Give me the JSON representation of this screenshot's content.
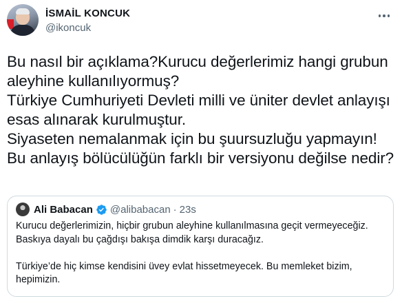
{
  "author": {
    "name": "İSMAİL KONCUK",
    "handle": "@ikoncuk"
  },
  "tweet_text": "Bu nasıl bir açıklama?Kurucu değerlerimiz hangi grubun aleyhine kullanılıyormuş?\nTürkiye Cumhuriyeti Devleti milli ve üniter devlet anlayışı esas alınarak kurulmuştur.\nSiyaseten nemalanmak için bu şuursuzluğu yapmayın!\nBu anlayış bölücülüğün farklı bir versiyonu değilse nedir?",
  "quoted": {
    "name": "Ali Babacan",
    "handle": "@alibabacan",
    "separator": "·",
    "time": "23s",
    "paragraph1": "Kurucu değerlerimizin, hiçbir grubun aleyhine kullanılmasına geçit vermeyeceğiz. Baskıya dayalı bu çağdışı bakışa dimdik karşı duracağız.",
    "paragraph2": "Türkiye’de hiç kimse kendisini üvey evlat hissetmeyecek. Bu memleket bizim, hepimizin."
  },
  "icons": {
    "more": "more-horizontal-icon",
    "verified": "verified-badge-icon"
  },
  "colors": {
    "text": "#0f1419",
    "secondary": "#536471",
    "border": "#cfd9de",
    "verified": "#1d9bf0"
  }
}
